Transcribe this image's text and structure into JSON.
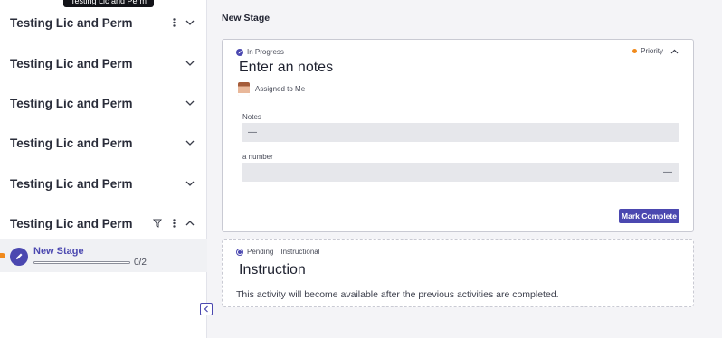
{
  "tooltip": "Testing Lic and Perm",
  "sidebar": {
    "groups": [
      {
        "title": "Testing Lic and Perm"
      },
      {
        "title": "Testing Lic and Perm"
      },
      {
        "title": "Testing Lic and Perm"
      },
      {
        "title": "Testing Lic and Perm"
      },
      {
        "title": "Testing Lic and Perm"
      },
      {
        "title": "Testing Lic and Perm"
      }
    ],
    "stage": {
      "name": "New Stage",
      "count": "0/2",
      "progress": 0
    }
  },
  "main": {
    "title": "New Stage",
    "activity": {
      "status": "In Progress",
      "priority": "Priority",
      "title": "Enter an notes",
      "assignee": "Assigned to Me",
      "fields": [
        {
          "label": "Notes",
          "value": "—"
        },
        {
          "label": "a number",
          "value": "—"
        }
      ],
      "button": "Mark Complete"
    },
    "pending": {
      "status": "Pending",
      "type": "Instructional",
      "title": "Instruction",
      "description": "This activity will become available after the previous activities are completed."
    }
  },
  "colors": {
    "accent": "#4b48b0",
    "priority": "#f08a1c",
    "background": "#f4f4f7"
  }
}
